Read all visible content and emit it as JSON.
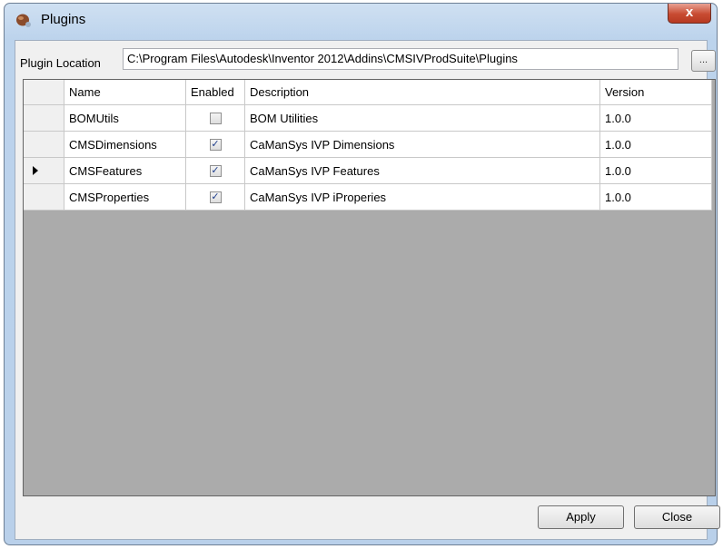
{
  "window": {
    "title": "Plugins",
    "close_glyph": "x"
  },
  "location": {
    "label": "Plugin Location",
    "value": "C:\\Program Files\\Autodesk\\Inventor 2012\\Addins\\CMSIVProdSuite\\Plugins",
    "browse_label": "..."
  },
  "grid": {
    "columns": [
      "Name",
      "Enabled",
      "Description",
      "Version"
    ],
    "rows": [
      {
        "name": "BOMUtils",
        "enabled": false,
        "description": "BOM Utilities",
        "version": "1.0.0"
      },
      {
        "name": "CMSDimensions",
        "enabled": true,
        "description": "CaManSys IVP Dimensions",
        "version": "1.0.0"
      },
      {
        "name": "CMSFeatures",
        "enabled": true,
        "description": "CaManSys IVP Features",
        "version": "1.0.0"
      },
      {
        "name": "CMSProperties",
        "enabled": true,
        "description": "CaManSys IVP iProperies",
        "version": "1.0.0"
      }
    ],
    "current_row": 2
  },
  "buttons": {
    "apply": "Apply",
    "close": "Close"
  },
  "icons": {
    "app": "plugin-icon",
    "check": "✓"
  }
}
